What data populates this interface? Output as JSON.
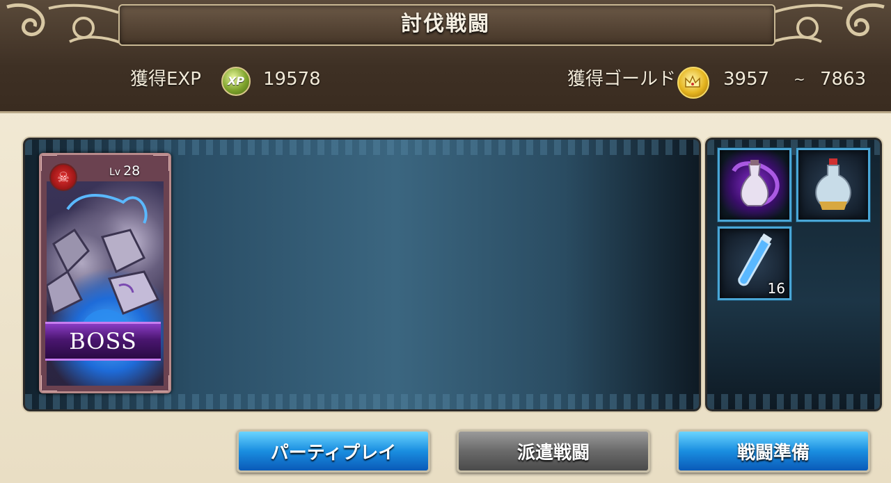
{
  "header": {
    "title": "討伐戦闘"
  },
  "rewards": {
    "exp_label": "獲得EXP",
    "exp_icon": "xp-icon",
    "exp_icon_text": "XP",
    "exp_value": "19578",
    "gold_label": "獲得ゴールド",
    "gold_icon": "gold-crown-coin-icon",
    "gold_min": "3957",
    "gold_separator": "~",
    "gold_max": "7863"
  },
  "boss": {
    "level_prefix": "Lv",
    "level": "28",
    "banner": "BOSS",
    "emblem_icon": "demon-emblem-icon"
  },
  "drops": [
    {
      "icon": "purple-potion-icon",
      "count": ""
    },
    {
      "icon": "white-potion-icon",
      "count": ""
    },
    {
      "icon": "blue-vial-icon",
      "count": "16"
    }
  ],
  "buttons": {
    "party_play": "パーティプレイ",
    "dispatch": "派遣戦闘",
    "prepare": "戦闘準備"
  },
  "colors": {
    "button_active": "#1a8ee0",
    "button_inactive": "#6a6a6a",
    "boss_banner": "#4a1670",
    "item_border": "#4aa6d6"
  }
}
